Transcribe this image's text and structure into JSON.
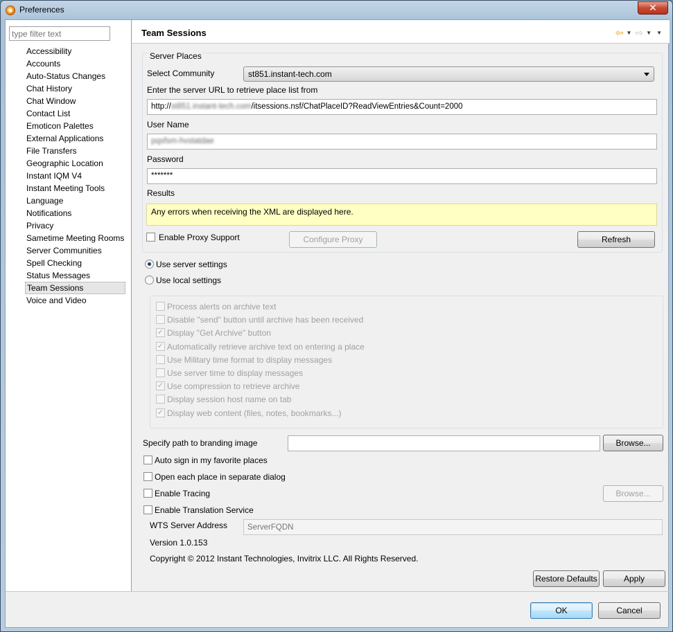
{
  "window": {
    "title": "Preferences",
    "close_glyph": "✕"
  },
  "sidebar": {
    "filter_placeholder": "type filter text",
    "items": [
      {
        "label": "Accessibility"
      },
      {
        "label": "Accounts"
      },
      {
        "label": "Auto-Status Changes"
      },
      {
        "label": "Chat History"
      },
      {
        "label": "Chat Window"
      },
      {
        "label": "Contact List"
      },
      {
        "label": "Emoticon Palettes"
      },
      {
        "label": "External Applications"
      },
      {
        "label": "File Transfers"
      },
      {
        "label": "Geographic Location"
      },
      {
        "label": "Instant IQM V4"
      },
      {
        "label": "Instant Meeting Tools"
      },
      {
        "label": "Language"
      },
      {
        "label": "Notifications"
      },
      {
        "label": "Privacy"
      },
      {
        "label": "Sametime Meeting Rooms"
      },
      {
        "label": "Server Communities"
      },
      {
        "label": "Spell Checking"
      },
      {
        "label": "Status Messages"
      },
      {
        "label": "Team Sessions",
        "selected": true
      },
      {
        "label": "Voice and Video"
      }
    ]
  },
  "page": {
    "title": "Team Sessions",
    "server_places": {
      "legend": "Server Places",
      "community_label": "Select Community",
      "community_value": "st851.instant-tech.com",
      "url_label": "Enter the server URL to retrieve place list from",
      "url_prefix": "http://",
      "url_host_blurred": "st851.instant-tech.com",
      "url_suffix": "/itsessions.nsf/ChatPlaceID?ReadViewEntries&Count=2000",
      "username_label": "User Name",
      "username_blurred": "pqsfsm-hvstatdae",
      "password_label": "Password",
      "password_value": "*******",
      "results_label": "Results",
      "results_text": "Any errors when receiving the XML are displayed here.",
      "proxy_label": "Enable Proxy Support",
      "configure_proxy": "Configure Proxy",
      "refresh": "Refresh"
    },
    "radio_server": "Use server settings",
    "radio_local": "Use local settings",
    "archive_options": [
      {
        "label": "Process alerts on archive text",
        "checked": false
      },
      {
        "label": "Disable \"send\" button until archive has been received",
        "checked": false
      },
      {
        "label": "Display \"Get Archive\" button",
        "checked": true
      },
      {
        "label": "Automatically retrieve archive text on entering a place",
        "checked": true
      },
      {
        "label": "Use Military time format to display messages",
        "checked": false
      },
      {
        "label": "Use server time to display messages",
        "checked": false
      },
      {
        "label": "Use compression to retrieve archive",
        "checked": true
      },
      {
        "label": "Display session host name on tab",
        "checked": false
      },
      {
        "label": "Display web content (files, notes, bookmarks...)",
        "checked": true
      }
    ],
    "branding_label": "Specify path to branding image",
    "branding_value": "",
    "browse": "Browse...",
    "browse_disabled": "Browse...",
    "auto_sign": "Auto sign in my favorite places",
    "open_each": "Open each place in separate dialog",
    "enable_tracing": "Enable Tracing",
    "enable_translation": "Enable Translation Service",
    "wts_label": "WTS Server Address",
    "wts_placeholder": "ServerFQDN",
    "version": "Version 1.0.153",
    "copyright": "Copyright © 2012 Instant Technologies,  Invitrix LLC. All Rights Reserved.",
    "restore_defaults": "Restore Defaults",
    "apply": "Apply"
  },
  "footer": {
    "ok": "OK",
    "cancel": "Cancel"
  },
  "icons": {
    "back": "⇦",
    "forward": "⇨",
    "caret": "▼",
    "check": "✓"
  }
}
